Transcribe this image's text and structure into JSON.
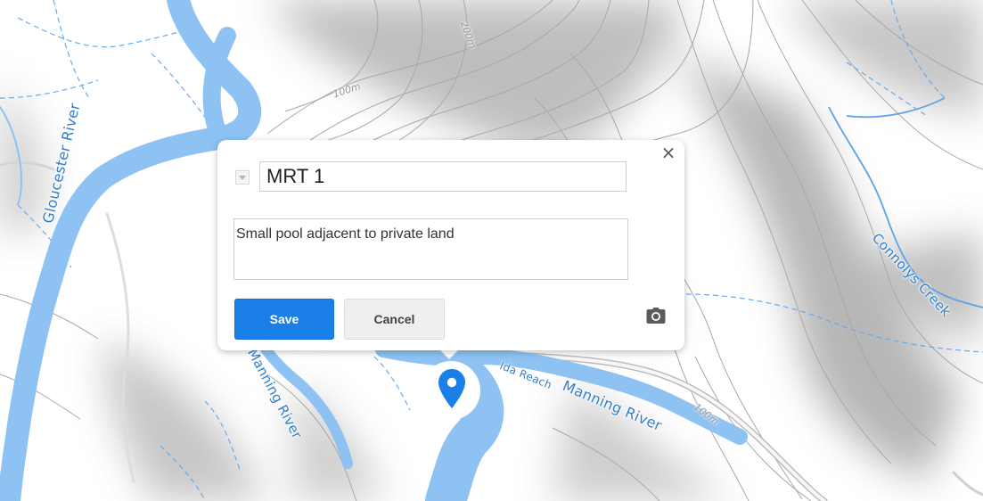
{
  "map": {
    "rivers": {
      "gloucester": "Gloucester River",
      "manning_left": "Manning River",
      "ida_reach": "Ida Reach",
      "manning_right": "Manning River",
      "connolys": "Connolys Creek"
    },
    "contours": {
      "c200": "200m",
      "c100_top": "100m",
      "c100_right": "100m"
    },
    "colors": {
      "water": "#8ec2f2",
      "water_label": "#2f7fd0",
      "contour": "#a8a8a8",
      "stream": "#6aaae8",
      "road": "#cfcfcf"
    }
  },
  "popup": {
    "title_value": "MRT 1",
    "description_value": "Small pool adjacent to private land",
    "save_label": "Save",
    "cancel_label": "Cancel",
    "close_glyph": "×",
    "camera_icon": "camera-icon",
    "accent_color": "#1a7fe6"
  },
  "marker": {
    "icon": "location-pin-icon",
    "color": "#1a7fe6"
  }
}
